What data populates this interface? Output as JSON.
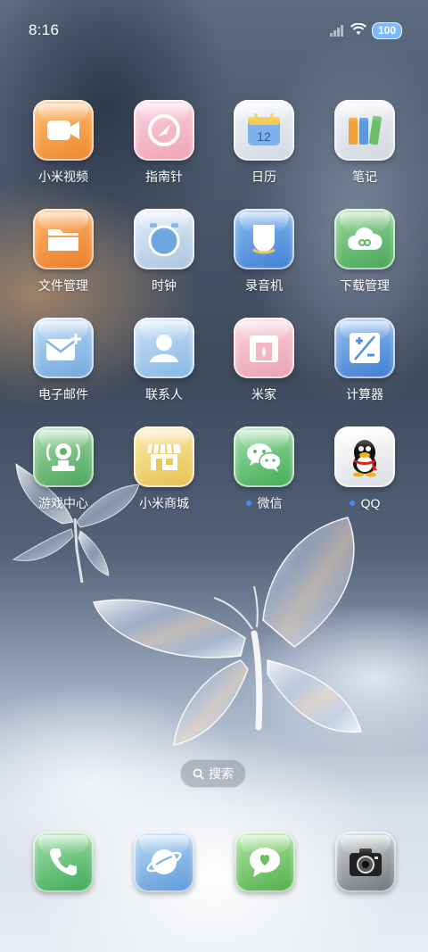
{
  "status_bar": {
    "time": "8:16",
    "battery": "100",
    "icons": [
      "signal-icon",
      "wifi-icon",
      "battery-icon"
    ]
  },
  "apps": [
    {
      "label": "小米视频",
      "icon": "video-camera-icon",
      "color": "#f29a3d"
    },
    {
      "label": "指南针",
      "icon": "compass-icon",
      "color": "#f3b6c6"
    },
    {
      "label": "日历",
      "icon": "calendar-icon",
      "color": "#dfe6ee",
      "day": "12"
    },
    {
      "label": "笔记",
      "icon": "notes-icon",
      "color": "#dfe5ea"
    },
    {
      "label": "文件管理",
      "icon": "folder-icon",
      "color": "#f08e3a"
    },
    {
      "label": "时钟",
      "icon": "clock-icon",
      "color": "#c8dbee"
    },
    {
      "label": "录音机",
      "icon": "recorder-icon",
      "color": "#4d8fe0"
    },
    {
      "label": "下载管理",
      "icon": "download-cloud-icon",
      "color": "#5cb86a"
    },
    {
      "label": "电子邮件",
      "icon": "mail-icon",
      "color": "#86b8e6"
    },
    {
      "label": "联系人",
      "icon": "contact-icon",
      "color": "#9ec6ea"
    },
    {
      "label": "米家",
      "icon": "home-icon",
      "color": "#f2b3c0"
    },
    {
      "label": "计算器",
      "icon": "calculator-icon",
      "color": "#5a9ae6"
    },
    {
      "label": "游戏中心",
      "icon": "game-center-icon",
      "color": "#62b56e"
    },
    {
      "label": "小米商城",
      "icon": "store-icon",
      "color": "#f0d67a"
    },
    {
      "label": "微信",
      "icon": "wechat-icon",
      "color": "#5cbb6b",
      "badge": true
    },
    {
      "label": "QQ",
      "icon": "qq-icon",
      "color": "#eef0f2",
      "badge": true
    }
  ],
  "search": {
    "label": "搜索"
  },
  "dock": [
    {
      "icon": "phone-icon",
      "color": "#5cc070"
    },
    {
      "icon": "browser-icon",
      "color": "#7fb3e8"
    },
    {
      "icon": "messages-icon",
      "color": "#6cc060"
    },
    {
      "icon": "camera-icon",
      "color": "#9aa0a6"
    }
  ]
}
